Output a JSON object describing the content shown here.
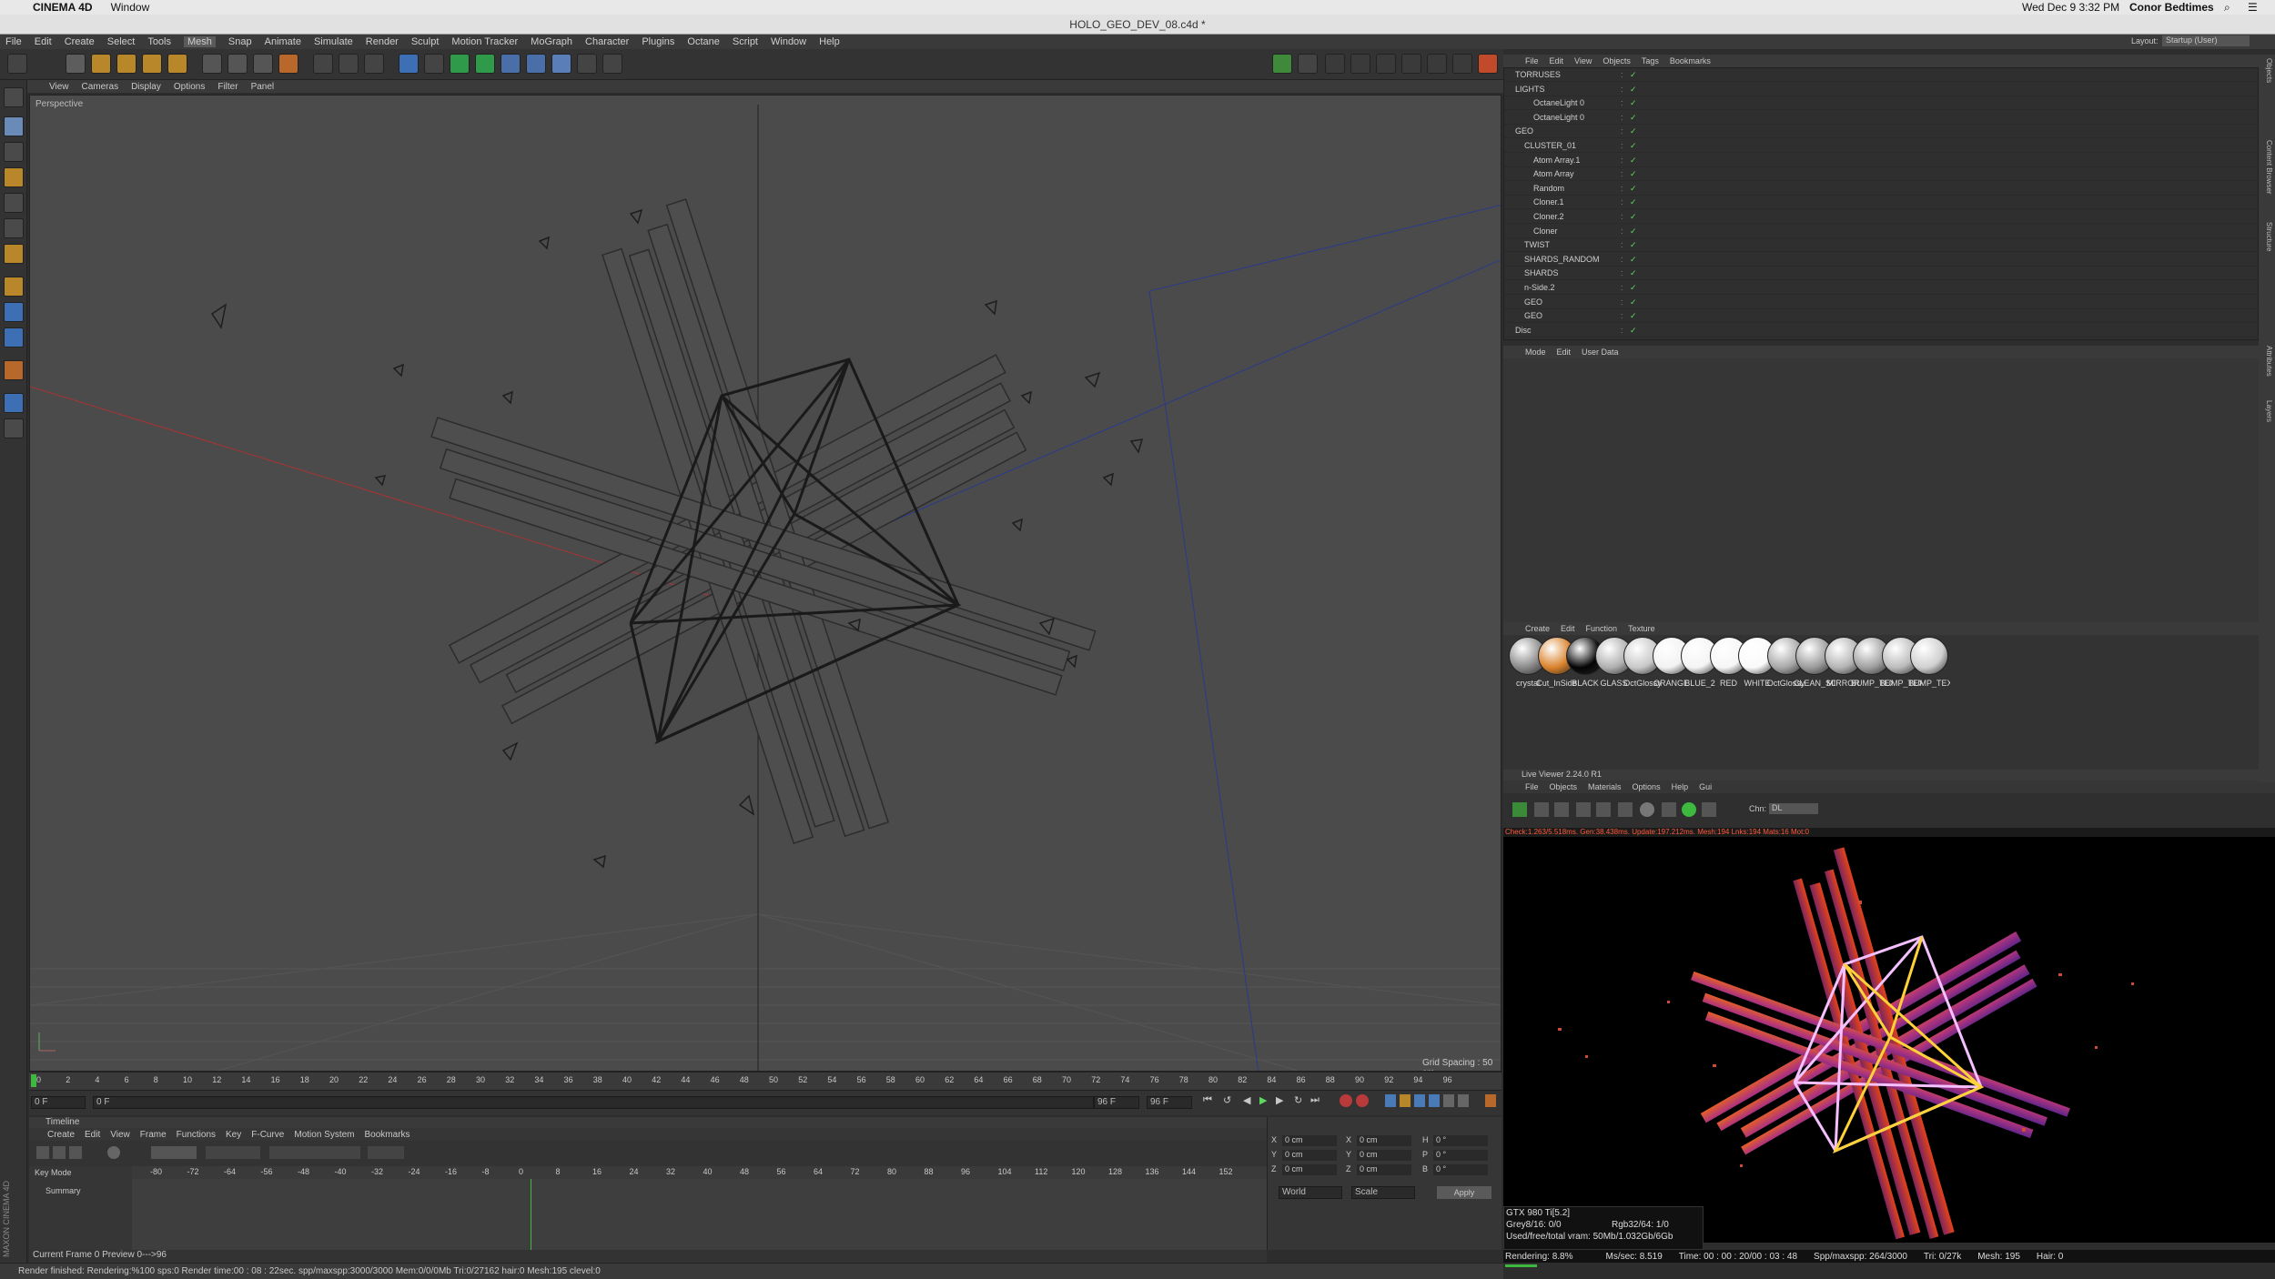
{
  "mac_menu": {
    "apple": "",
    "app": "CINEMA 4D",
    "window": "Window",
    "clock": "Wed Dec 9  3:32 PM",
    "user": "Conor Bedtimes"
  },
  "title": "HOLO_GEO_DEV_08.c4d *",
  "menu": [
    "File",
    "Edit",
    "Create",
    "Select",
    "Tools",
    "Mesh",
    "Snap",
    "Animate",
    "Simulate",
    "Render",
    "Sculpt",
    "Motion Tracker",
    "MoGraph",
    "Character",
    "Plugins",
    "Octane",
    "Script",
    "Window",
    "Help"
  ],
  "layout": {
    "label": "Layout:",
    "value": "Startup (User)"
  },
  "viewport": {
    "menu": [
      "View",
      "Cameras",
      "Display",
      "Options",
      "Filter",
      "Panel"
    ],
    "label": "Perspective",
    "grid_spacing": "Grid Spacing : 50 cm"
  },
  "ruler_ticks": [
    "0",
    "2",
    "4",
    "6",
    "8",
    "10",
    "12",
    "14",
    "16",
    "18",
    "20",
    "22",
    "24",
    "26",
    "28",
    "30",
    "32",
    "34",
    "36",
    "38",
    "40",
    "42",
    "44",
    "46",
    "48",
    "50",
    "52",
    "54",
    "56",
    "58",
    "60",
    "62",
    "64",
    "66",
    "68",
    "70",
    "72",
    "74",
    "76",
    "78",
    "80",
    "82",
    "84",
    "86",
    "88",
    "90",
    "92",
    "94",
    "96"
  ],
  "frame_fields": {
    "start": "0 F",
    "current": "0 F",
    "end": "96 F",
    "end2": "96 F",
    "right": "0 F"
  },
  "timeline": {
    "title": "Timeline",
    "menu": [
      "Create",
      "Edit",
      "View",
      "Frame",
      "Functions",
      "Key",
      "F-Curve",
      "Motion System",
      "Bookmarks"
    ],
    "key_mode": "Key Mode",
    "summary": "Summary",
    "ticks": [
      "-80",
      "-72",
      "-64",
      "-56",
      "-48",
      "-40",
      "-32",
      "-24",
      "-16",
      "-8",
      "0",
      "8",
      "16",
      "24",
      "32",
      "40",
      "48",
      "56",
      "64",
      "72",
      "80",
      "88",
      "96",
      "104",
      "112",
      "120",
      "128",
      "136",
      "144",
      "152"
    ],
    "current_frame": "Current Frame  0  Preview  0--->96"
  },
  "coords": {
    "rows": [
      [
        "X",
        "0 cm",
        "X",
        "0 cm",
        "H",
        "0 °"
      ],
      [
        "Y",
        "0 cm",
        "Y",
        "0 cm",
        "P",
        "0 °"
      ],
      [
        "Z",
        "0 cm",
        "Z",
        "0 cm",
        "B",
        "0 °"
      ]
    ],
    "world": "World",
    "scale": "Scale",
    "apply": "Apply"
  },
  "status": "Render finished: Rendering:%100 sps:0 Render time:00 : 08 : 22sec. spp/maxspp:3000/3000 Mem:0/0/0Mb Tri:0/27162 hair:0 Mesh:195 clevel:0",
  "objects": {
    "menu": [
      "File",
      "Edit",
      "View",
      "Objects",
      "Tags",
      "Bookmarks"
    ],
    "items": [
      {
        "name": "TORRUSES",
        "indent": 0
      },
      {
        "name": "LIGHTS",
        "indent": 0
      },
      {
        "name": "OctaneLight 0",
        "indent": 2
      },
      {
        "name": "OctaneLight 0",
        "indent": 2
      },
      {
        "name": "GEO",
        "indent": 0
      },
      {
        "name": "CLUSTER_01",
        "indent": 1
      },
      {
        "name": "Atom Array.1",
        "indent": 2
      },
      {
        "name": "Atom Array",
        "indent": 2
      },
      {
        "name": "Random",
        "indent": 2
      },
      {
        "name": "Cloner.1",
        "indent": 2
      },
      {
        "name": "Cloner.2",
        "indent": 2
      },
      {
        "name": "Cloner",
        "indent": 2
      },
      {
        "name": "TWIST",
        "indent": 1
      },
      {
        "name": "SHARDS_RANDOM",
        "indent": 1
      },
      {
        "name": "SHARDS",
        "indent": 1
      },
      {
        "name": "n-Side.2",
        "indent": 1
      },
      {
        "name": "GEO",
        "indent": 1
      },
      {
        "name": "GEO",
        "indent": 1
      },
      {
        "name": "Disc",
        "indent": 0
      }
    ]
  },
  "attributes": {
    "menu": [
      "Mode",
      "Edit",
      "User Data"
    ]
  },
  "materials": {
    "menu": [
      "Create",
      "Edit",
      "Function",
      "Texture"
    ],
    "items": [
      {
        "label": "crystal",
        "color": "#8a8a8a"
      },
      {
        "label": "Cut_InSide",
        "color": "#d9822b"
      },
      {
        "label": "BLACK",
        "color": "#050505"
      },
      {
        "label": "GLASS",
        "color": "#b0b0b0"
      },
      {
        "label": "OctGlossy",
        "color": "#c8c8c8"
      },
      {
        "label": "ORANGE",
        "color": "#f2f2f2"
      },
      {
        "label": "BLUE_2",
        "color": "#f4f4f4"
      },
      {
        "label": "RED",
        "color": "#f6f6f6"
      },
      {
        "label": "WHITE",
        "color": "#fafafa"
      },
      {
        "label": "OctGlossy",
        "color": "#a8a8a8"
      },
      {
        "label": "CLEAN_SCI",
        "color": "#9c9c9c"
      },
      {
        "label": "MIRROR",
        "color": "#b4b4b4"
      },
      {
        "label": "BUMP_TEX",
        "color": "#a0a0a0"
      },
      {
        "label": "BUMP_TEX",
        "color": "#bcbcbc"
      },
      {
        "label": "BUMP_TEX",
        "color": "#d0d0d0"
      }
    ]
  },
  "live_viewer": {
    "title": "Live Viewer 2.24.0 R1",
    "menu": [
      "File",
      "Objects",
      "Materials",
      "Options",
      "Help",
      "Gui"
    ],
    "chn_label": "Chn:",
    "chn_value": "DL",
    "stats": "Check:1.263/5.518ms. Gen:38.438ms. Update:197.212ms. Mesh:194 Lnks:194 Mats:16 Mot:0",
    "gpu": "GTX 980 Ti[5.2]",
    "grey": "Grey8/16: 0/0",
    "rgb": "Rgb32/64: 1/0",
    "vram": "Used/free/total vram: 50Mb/1.032Gb/6Gb",
    "rendering": "Rendering: 8.8%",
    "progress": 0.088,
    "ms": "Ms/sec: 8.519",
    "time": "Time: 00 : 00 : 20/00 : 03 : 48",
    "spp": "Spp/maxspp: 264/3000",
    "tri": "Tri: 0/27k",
    "mesh": "Mesh: 195",
    "hair": "Hair: 0"
  },
  "right_tabs": [
    "Objects",
    "Content Browser",
    "Structure"
  ],
  "right_tabs2": [
    "Attributes",
    "Layers"
  ],
  "cinema_brand": "MAXON CINEMA 4D"
}
